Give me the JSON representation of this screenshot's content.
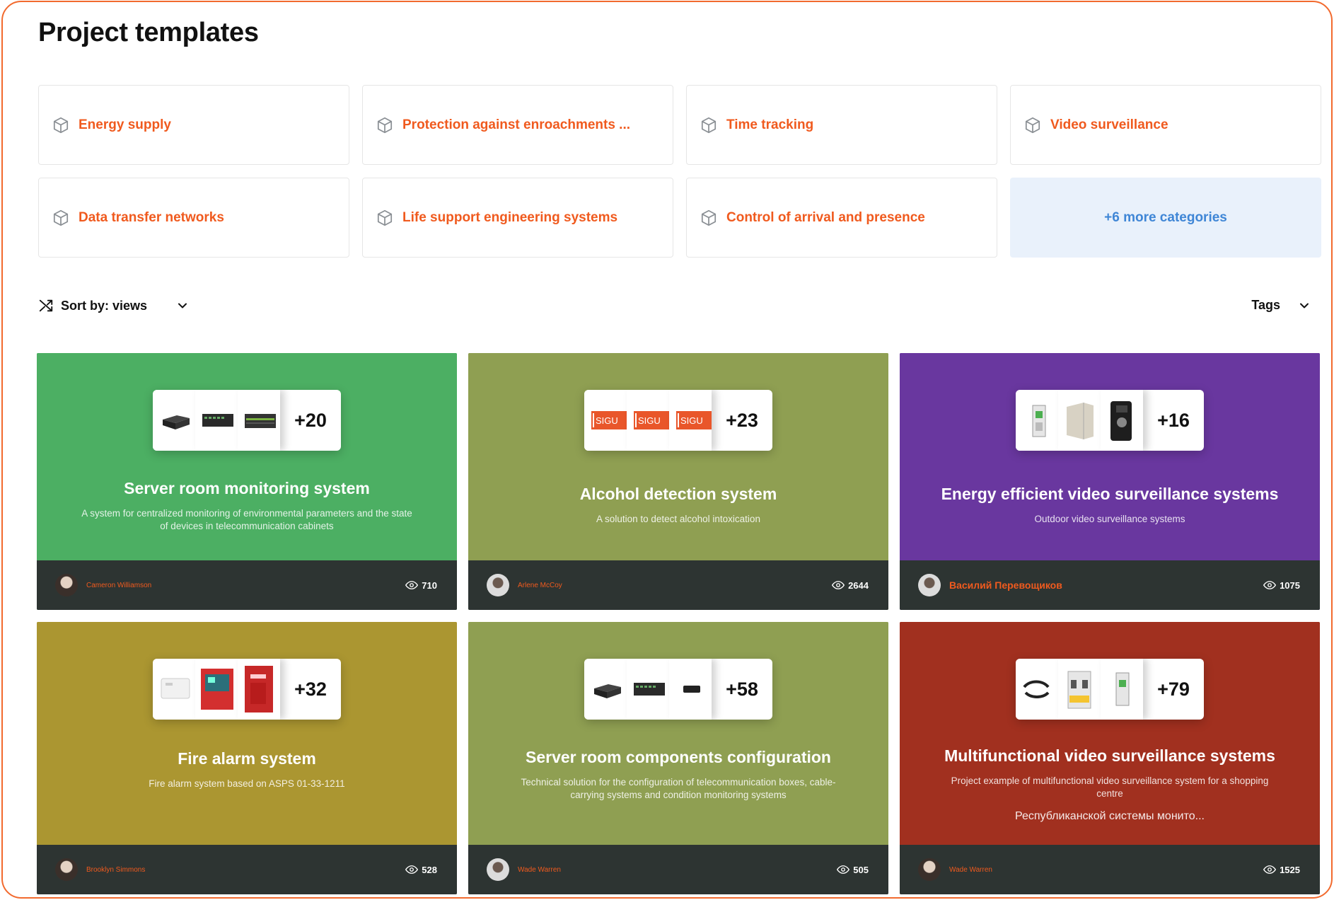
{
  "page": {
    "title": "Project templates"
  },
  "categories": [
    {
      "label": "Energy supply",
      "icon": "box-icon"
    },
    {
      "label": "Protection against enroachments ...",
      "icon": "box-icon"
    },
    {
      "label": "Time tracking",
      "icon": "box-icon"
    },
    {
      "label": "Video surveillance",
      "icon": "box-icon"
    },
    {
      "label": "Data transfer networks",
      "icon": "box-icon"
    },
    {
      "label": "Life support engineering systems",
      "icon": "box-icon"
    },
    {
      "label": "Control of arrival and presence",
      "icon": "box-icon"
    }
  ],
  "more_categories": {
    "label": "+6 more categories"
  },
  "sort": {
    "label": "Sort by: views",
    "icon": "shuffle-icon"
  },
  "tags": {
    "label": "Tags"
  },
  "colors": {
    "accent": "#f05a1e",
    "link_blue": "#3f86d6",
    "footer_bg": "#2d3432"
  },
  "cards": [
    {
      "color": "#4caf63",
      "more": "+20",
      "title": "Server room monitoring system",
      "desc": "A system for centralized monitoring of environmental parameters and the state of devices in telecommunication cabinets",
      "extra": "",
      "author": "Cameron Williamson",
      "views": "710"
    },
    {
      "color": "#8f9f52",
      "more": "+23",
      "title": "Alcohol detection system",
      "desc": "A solution to detect alcohol intoxication",
      "extra": "",
      "author": "Arlene McCoy",
      "views": "2644"
    },
    {
      "color": "#69379f",
      "more": "+16",
      "title": "Energy efficient video surveillance systems",
      "desc": "Outdoor video surveillance systems",
      "extra": "",
      "author": "Василий Перевощиков",
      "views": "1075"
    },
    {
      "color": "#ab9631",
      "more": "+32",
      "title": "Fire alarm system",
      "desc": "Fire alarm system based on ASPS 01-33-1211",
      "extra": "",
      "author": "Brooklyn Simmons",
      "views": "528"
    },
    {
      "color": "#8f9f52",
      "more": "+58",
      "title": "Server room components configuration",
      "desc": "Technical solution for the configuration of telecommunication boxes, cable-carrying systems and condition monitoring systems",
      "extra": "",
      "author": "Wade Warren",
      "views": "505"
    },
    {
      "color": "#a1301f",
      "more": "+79",
      "title": "Multifunctional video surveillance systems",
      "desc": "Project example of multifunctional video surveillance system for a shopping centre",
      "extra": "Республиканской системы монито...",
      "author": "Wade Warren",
      "views": "1525"
    }
  ]
}
